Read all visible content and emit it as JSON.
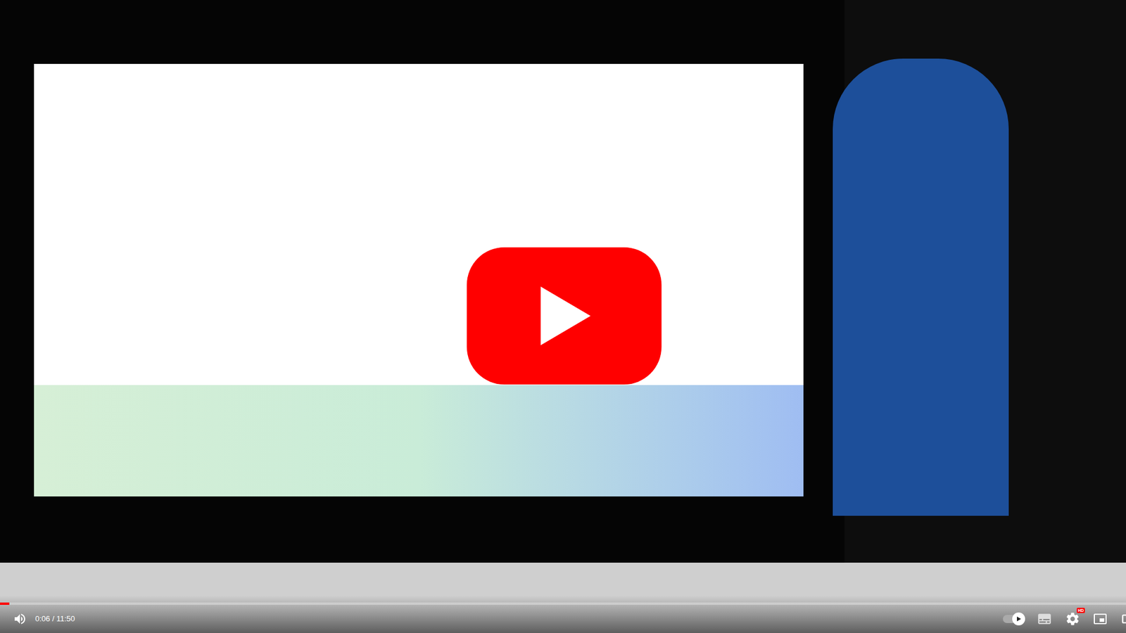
{
  "player": {
    "time": "0:06 / 11:50",
    "progress": 0.0085,
    "muted": false,
    "autoplay": true,
    "captions": false,
    "settings_badge": "HD"
  },
  "overlay": {
    "play_button_visible": true
  }
}
